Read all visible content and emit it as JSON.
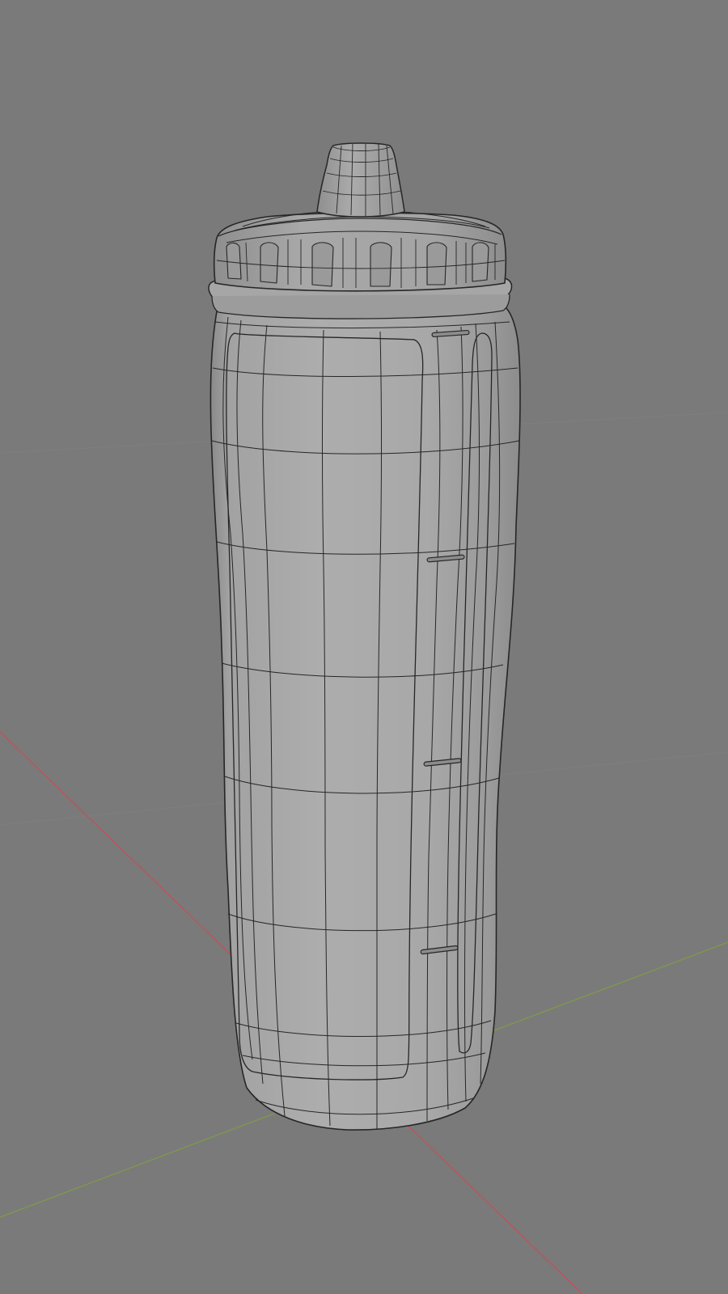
{
  "viewport": {
    "background": "#7a7a7a",
    "grid_color": "#858585",
    "axis_x_color": "#c2505a",
    "axis_y_color": "#7d9a4a",
    "mesh_fill": "#a3a3a3",
    "mesh_shadow": "#8d8d8d",
    "mesh_highlight": "#b4b4b4",
    "wire_color": "#262626"
  },
  "scene": {
    "object": "bottle-mesh",
    "shading": "solid-with-wireframe"
  }
}
